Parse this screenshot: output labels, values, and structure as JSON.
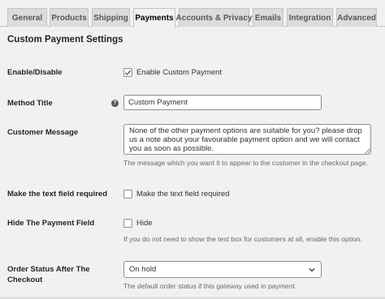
{
  "tabs": [
    {
      "label": "General",
      "active": false
    },
    {
      "label": "Products",
      "active": false
    },
    {
      "label": "Shipping",
      "active": false
    },
    {
      "label": "Payments",
      "active": true
    },
    {
      "label": "Accounts & Privacy",
      "active": false
    },
    {
      "label": "Emails",
      "active": false
    },
    {
      "label": "Integration",
      "active": false
    },
    {
      "label": "Advanced",
      "active": false
    }
  ],
  "section_title": "Custom Payment Settings",
  "fields": {
    "enable": {
      "label": "Enable/Disable",
      "checkbox_label": "Enable Custom Payment",
      "checked": true
    },
    "method_title": {
      "label": "Method Title",
      "value": "Custom Payment",
      "help_icon": "question-circle-icon"
    },
    "customer_message": {
      "label": "Customer Message",
      "value": "None of the other payment options are suitable for you? please drop us a note about your favourable payment option and we will contact you as soon as possible.",
      "description": "The message which you want it to appear to the customer in the checkout page."
    },
    "text_required": {
      "label": "Make the text field required",
      "checkbox_label": "Make the text field required",
      "checked": false
    },
    "hide_field": {
      "label": "Hide The Payment Field",
      "checkbox_label": "Hide",
      "checked": false,
      "description": "If you do not need to show the text box for customers at all, enable this option."
    },
    "order_status": {
      "label_line1": "Order Status After The",
      "label_line2": "Checkout",
      "value": "On hold",
      "description": "The default order status if this gateway used in payment."
    }
  },
  "colors": {
    "accent": "#2271b1",
    "text": "#1d2327",
    "muted": "#646970",
    "tab_bg": "#dcdcde",
    "page_bg": "#f1f1f1"
  }
}
